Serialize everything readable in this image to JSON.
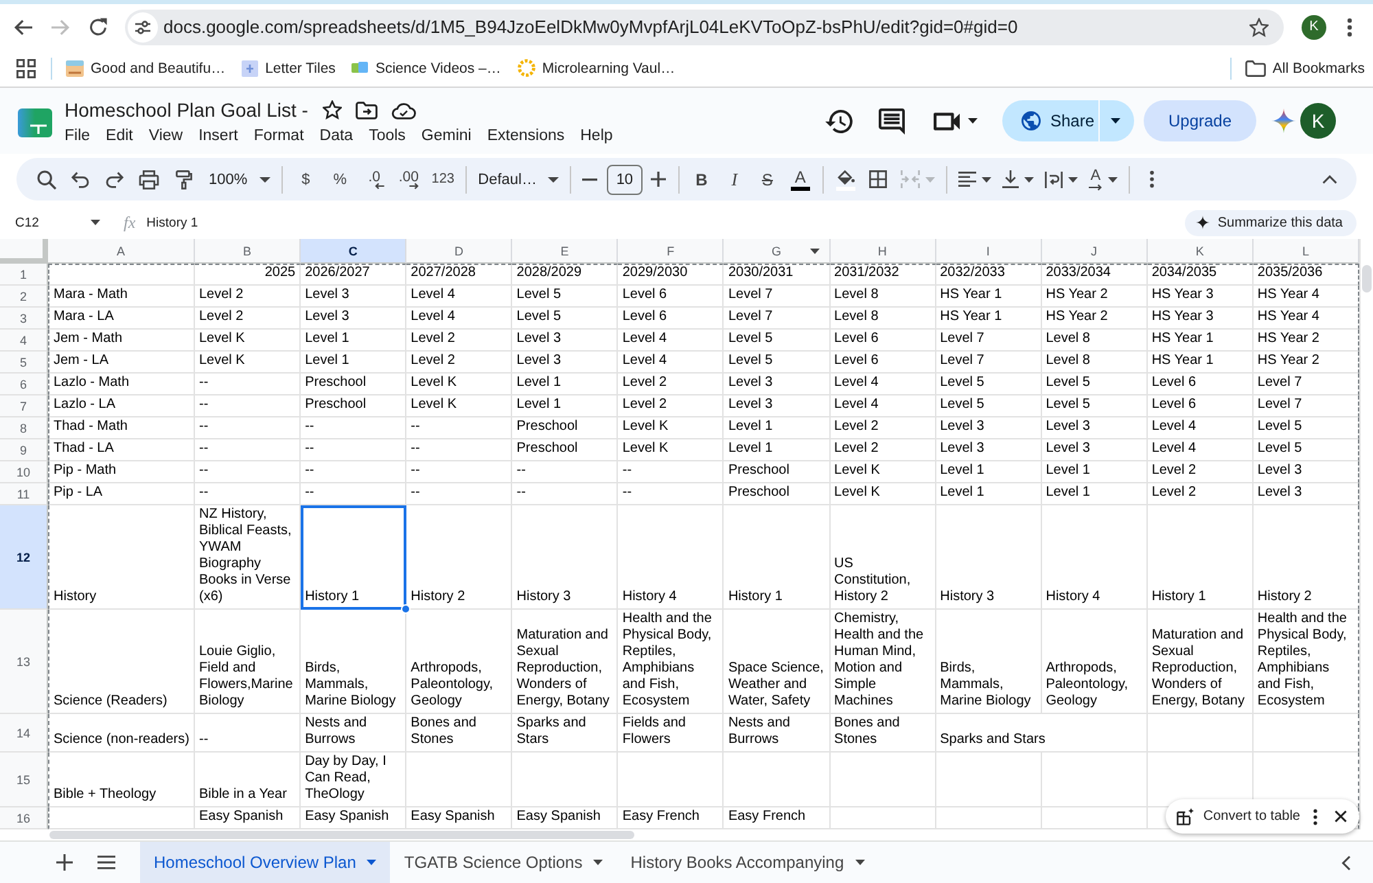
{
  "browser": {
    "forward_disabled": true,
    "url": "docs.google.com/spreadsheets/d/1M5_B94JzoEelDkMw0yMvpfArjL04LeKVToOpZ-bsPhU/edit?gid=0#gid=0",
    "profile_initial": "K",
    "bookmarks": [
      "Good and Beautifu…",
      "Letter Tiles",
      "Science Videos –…",
      "Microlearning Vaul…"
    ],
    "all_bookmarks": "All Bookmarks"
  },
  "document": {
    "title": "Homeschool Plan Goal List -",
    "menu": [
      "File",
      "Edit",
      "View",
      "Insert",
      "Format",
      "Data",
      "Tools",
      "Gemini",
      "Extensions",
      "Help"
    ],
    "share": "Share",
    "upgrade": "Upgrade",
    "account_initial": "K"
  },
  "toolbar": {
    "zoom": "100%",
    "currency": "$",
    "percent": "%",
    "decrease_decimal": ".0",
    "increase_decimal": ".00",
    "number_formats": "123",
    "font": "Defaul…",
    "font_size": "10",
    "bold": "B",
    "italic": "I",
    "strikethrough": "S",
    "text_color": "A",
    "text_rotation": "A",
    "merge_disabled": true
  },
  "formula_bar": {
    "cell": "C12",
    "fx": "fx",
    "formula": "History 1",
    "summarize": "Summarize this data"
  },
  "sheet": {
    "copy_outline": true,
    "columns": [
      {
        "label": "A",
        "selected": false,
        "dropdown": false
      },
      {
        "label": "B",
        "selected": false,
        "dropdown": false
      },
      {
        "label": "C",
        "selected": true,
        "dropdown": false
      },
      {
        "label": "D",
        "selected": false,
        "dropdown": false
      },
      {
        "label": "E",
        "selected": false,
        "dropdown": false
      },
      {
        "label": "F",
        "selected": false,
        "dropdown": false
      },
      {
        "label": "G",
        "selected": false,
        "dropdown": true
      },
      {
        "label": "H",
        "selected": false,
        "dropdown": false
      },
      {
        "label": "I",
        "selected": false,
        "dropdown": false
      },
      {
        "label": "J",
        "selected": false,
        "dropdown": false
      },
      {
        "label": "K",
        "selected": false,
        "dropdown": false
      },
      {
        "label": "L",
        "selected": false,
        "dropdown": false
      }
    ],
    "rows": [
      {
        "number": "1",
        "selected": false,
        "cells": [
          null,
          {
            "text": "2025",
            "right_aligned": true
          },
          "2026/2027",
          "2027/2028",
          "2028/2029",
          "2029/2030",
          "2030/2031",
          "2031/2032",
          "2032/2033",
          "2033/2034",
          "2034/2035",
          "2035/2036"
        ]
      },
      {
        "number": "2",
        "selected": false,
        "cells": [
          "Mara - Math",
          "Level 2",
          "Level 3",
          "Level 4",
          "Level 5",
          "Level 6",
          "Level 7",
          "Level 8",
          "HS Year 1",
          "HS Year 2",
          "HS Year 3",
          "HS Year 4"
        ]
      },
      {
        "number": "3",
        "selected": false,
        "cells": [
          "Mara - LA",
          "Level 2",
          "Level 3",
          "Level 4",
          "Level 5",
          "Level 6",
          "Level 7",
          "Level 8",
          "HS Year 1",
          "HS Year 2",
          "HS Year 3",
          "HS Year 4"
        ]
      },
      {
        "number": "4",
        "selected": false,
        "cells": [
          "Jem - Math",
          "Level K",
          "Level 1",
          "Level 2",
          "Level 3",
          "Level 4",
          "Level 5",
          "Level 6",
          "Level 7",
          "Level 8",
          "HS Year 1",
          "HS Year 2"
        ]
      },
      {
        "number": "5",
        "selected": false,
        "cells": [
          "Jem - LA",
          "Level K",
          "Level 1",
          "Level 2",
          "Level 3",
          "Level 4",
          "Level 5",
          "Level 6",
          "Level 7",
          "Level 8",
          "HS Year 1",
          "HS Year 2"
        ]
      },
      {
        "number": "6",
        "selected": false,
        "cells": [
          "Lazlo - Math",
          "--",
          "Preschool",
          "Level K",
          "Level 1",
          "Level 2",
          "Level 3",
          "Level 4",
          "Level 5",
          "Level 5",
          "Level 6",
          "Level 7"
        ]
      },
      {
        "number": "7",
        "selected": false,
        "cells": [
          "Lazlo - LA",
          "--",
          "Preschool",
          "Level K",
          "Level 1",
          "Level 2",
          "Level 3",
          "Level 4",
          "Level 5",
          "Level 5",
          "Level 6",
          "Level 7"
        ]
      },
      {
        "number": "8",
        "selected": false,
        "cells": [
          "Thad - Math",
          "--",
          "--",
          "--",
          "Preschool",
          "Level K",
          "Level 1",
          "Level 2",
          "Level 3",
          "Level 3",
          "Level 4",
          "Level 5"
        ]
      },
      {
        "number": "9",
        "selected": false,
        "cells": [
          "Thad - LA",
          "--",
          "--",
          "--",
          "Preschool",
          "Level K",
          "Level 1",
          "Level 2",
          "Level 3",
          "Level 3",
          "Level 4",
          "Level 5"
        ]
      },
      {
        "number": "10",
        "selected": false,
        "cells": [
          "Pip - Math",
          "--",
          "--",
          "--",
          "--",
          "--",
          "Preschool",
          "Level K",
          "Level 1",
          "Level 1",
          "Level 2",
          "Level 3"
        ]
      },
      {
        "number": "11",
        "selected": false,
        "cells": [
          "Pip - LA",
          "--",
          "--",
          "--",
          "--",
          "--",
          "Preschool",
          "Level K",
          "Level 1",
          "Level 1",
          "Level 2",
          "Level 3"
        ]
      },
      {
        "number": "12",
        "selected": true,
        "cells": [
          "History",
          "NZ History, Biblical Feasts, YWAM Biography Books in Verse (x6)",
          "History 1",
          "History 2",
          "History 3",
          "History 4",
          "History 1",
          "US Constitution, History 2",
          "History 3",
          "History 4",
          "History 1",
          "History 2"
        ]
      },
      {
        "number": "13",
        "selected": false,
        "cells": [
          "Science (Readers)",
          "Louie Giglio, Field and Flowers,Marine Biology",
          "Birds, Mammals, Marine Biology",
          "Arthropods, Paleontology, Geology",
          "Maturation and Sexual Reproduction, Wonders of Energy, Botany",
          "Health and the Physical Body, Reptiles, Amphibians and Fish, Ecosystem",
          "Space Science, Weather and Water, Safety",
          "Chemistry, Health and the Human Mind, Motion and Simple Machines",
          "Birds, Mammals, Marine Biology",
          "Arthropods, Paleontology, Geology",
          "Maturation and Sexual Reproduction, Wonders of Energy, Botany",
          "Health and the Physical Body, Reptiles, Amphibians and Fish, Ecosystem"
        ]
      },
      {
        "number": "14",
        "selected": false,
        "cells": [
          "Science (non-readers)",
          "--",
          "Nests and Burrows",
          "Bones and Stones",
          "Sparks and Stars",
          "Fields and Flowers",
          "Nests and Burrows",
          "Bones and Stones",
          {
            "text": "Sparks and Stars",
            "overflow": true
          },
          null,
          null,
          null
        ]
      },
      {
        "number": "15",
        "selected": false,
        "cells": [
          "Bible + Theology",
          "Bible in a Year",
          "Day by Day, I Can Read, TheOlogy",
          null,
          null,
          null,
          null,
          null,
          null,
          null,
          null,
          null
        ]
      },
      {
        "number": "16",
        "selected": false,
        "cells": [
          null,
          "Easy Spanish",
          "Easy Spanish",
          "Easy Spanish",
          "Easy Spanish",
          "Easy French",
          "Easy French",
          null,
          null,
          null,
          null,
          null
        ]
      }
    ]
  },
  "popup": {
    "label": "Convert to table"
  },
  "sheet_tabs": [
    {
      "label": "Homeschool Overview Plan",
      "selected": true
    },
    {
      "label": "TGATB Science Options",
      "selected": false
    },
    {
      "label": "History Books Accompanying",
      "selected": false
    }
  ]
}
